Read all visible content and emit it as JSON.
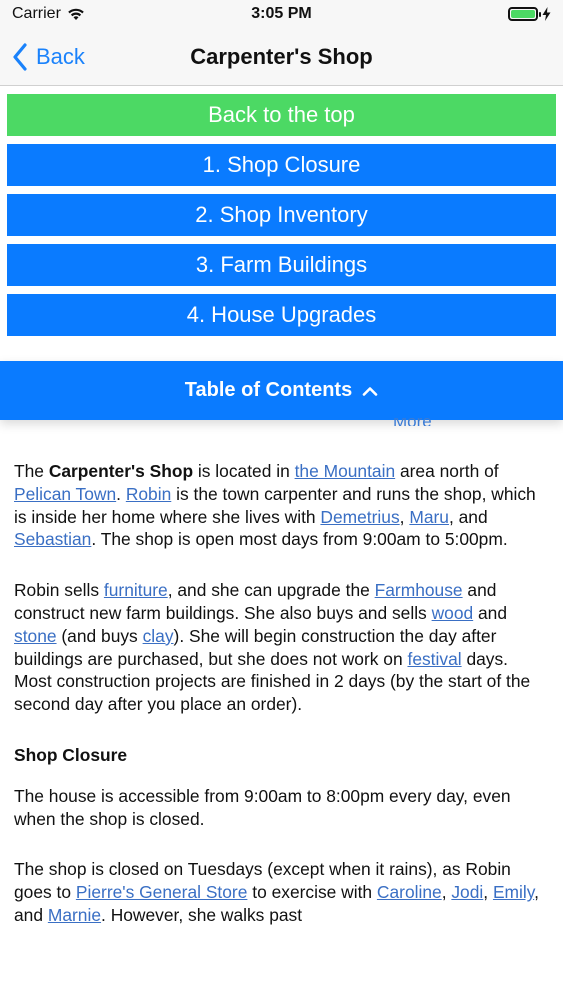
{
  "status": {
    "carrier": "Carrier",
    "time": "3:05 PM"
  },
  "nav": {
    "back_label": "Back",
    "title": "Carpenter's Shop"
  },
  "toc": {
    "top_button": "Back to the top",
    "items": [
      "1. Shop Closure",
      "2. Shop Inventory",
      "3. Farm Buildings",
      "4. House Upgrades"
    ],
    "header": "Table of Contents",
    "peek_link": "More"
  },
  "content": {
    "p1": {
      "t1": "The ",
      "bold": "Carpenter's Shop",
      "t2": " is located in ",
      "link1": "the Mountain",
      "t3": " area north of ",
      "link2": "Pelican Town",
      "t4": ". ",
      "link3": "Robin",
      "t5": " is the town carpenter and runs the shop, which is inside her home where she lives with ",
      "link4": "Demetrius",
      "t6": ", ",
      "link5": "Maru",
      "t7": ", and ",
      "link6": "Sebastian",
      "t8": ". The shop is open most days from 9:00am to 5:00pm."
    },
    "p2": {
      "t1": "Robin sells ",
      "link1": "furniture",
      "t2": ", and she can upgrade the ",
      "link2": "Farmhouse",
      "t3": " and construct new farm buildings. She also buys and sells ",
      "link3": "wood",
      "t4": " and ",
      "link4": "stone",
      "t5": " (and buys ",
      "link5": "clay",
      "t6": "). She will begin construction the day after buildings are purchased, but she does not work on ",
      "link6": "festival",
      "t7": " days. Most construction projects are finished in 2 days (by the start of the second day after you place an order)."
    },
    "section1_title": "Shop Closure",
    "p3": "The house is accessible from 9:00am to 8:00pm every day, even when the shop is closed.",
    "p4": {
      "t1": "The shop is closed on Tuesdays (except when it rains), as Robin goes to ",
      "link1": "Pierre's General Store",
      "t2": " to exercise with ",
      "link2": "Caroline",
      "t3": ", ",
      "link3": "Jodi",
      "t4": ", ",
      "link4": "Emily",
      "t5": ", and ",
      "link5": "Marnie",
      "t6": ". However, she walks past"
    }
  }
}
